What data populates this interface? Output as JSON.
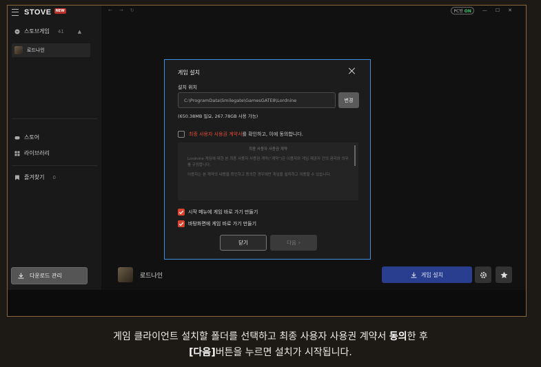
{
  "app": {
    "logo": "STOVE",
    "new_badge": "NEW"
  },
  "sidebar": {
    "section_title": "스토브게임",
    "section_count": "41",
    "game_item": "로드나인",
    "store": "스토어",
    "library": "라이브러리",
    "favorites": "즐겨찾기",
    "favorites_count": "0",
    "download_manager": "다운로드 관리"
  },
  "topbar": {
    "pc_on_label": "PC방",
    "pc_on_state": "ON"
  },
  "bottom": {
    "game_name": "로드나인",
    "install_button": "게임 설치"
  },
  "dialog": {
    "title": "게임 설치",
    "location_label": "설치 위치",
    "path_value": "C:\\ProgramData\\Smilegate\\GamesGATE8\\Lordnine",
    "change_button": "변경",
    "space_info": "(650.38MB 필요, 267.78GB 사용 가능)",
    "agree_highlight": "최종 사용자 사용권 계약서",
    "agree_rest": "를 확인하고, 이에 동의합니다.",
    "terms_title": "최종 사용자 사용권 계약",
    "terms_p1": "Lordnine 게임에 대한 본 최종 사용자 사용권 계약(“계약”)은 이용자와 게임 제공자 간의 권리와 의무를 규정합니다.",
    "terms_p2": "이용자는 본 계약의 내용을 확인하고 동의한 경우에만 게임을 설치하고 이용할 수 있습니다.",
    "start_menu_shortcut": "시작 메뉴에 게임 바로 가기 만들기",
    "desktop_shortcut": "바탕화면에 게임 바로 가기 만들기",
    "close_button": "닫기",
    "next_button": "다음"
  },
  "caption": {
    "line1_a": "게임 클라이언트 설치할 폴더를 선택하고 최종 사용자 사용권 계약서 ",
    "line1_bold": "동의",
    "line1_b": "한 후",
    "line2_bold": "[다음]",
    "line2_rest": "버튼을 누르면 설치가 시작됩니다."
  }
}
